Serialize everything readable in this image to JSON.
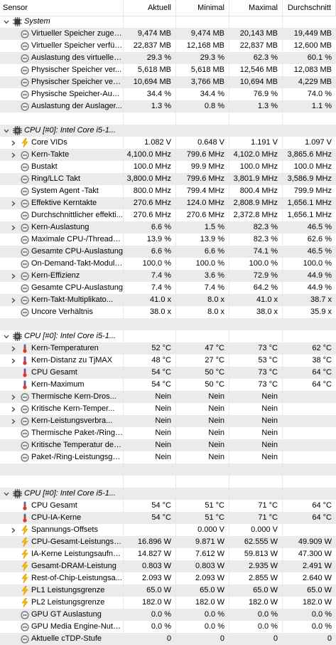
{
  "columns": [
    "Sensor",
    "Aktuell",
    "Minimal",
    "Maximal",
    "Durchschnitt"
  ],
  "rows": [
    {
      "type": "group",
      "indent": 0,
      "expander": "down",
      "icon": "memory-chip-icon",
      "label": "System"
    },
    {
      "type": "item",
      "indent": 1,
      "expander": "",
      "icon": "minus-circle-icon",
      "label": "Virtueller Speicher zugew...",
      "v": [
        "9,474 MB",
        "9,474 MB",
        "20,143 MB",
        "19,449 MB"
      ]
    },
    {
      "type": "item",
      "indent": 1,
      "expander": "",
      "icon": "minus-circle-icon",
      "label": "Virtueller Speicher verfüg...",
      "v": [
        "22,837 MB",
        "12,168 MB",
        "22,837 MB",
        "12,600 MB"
      ]
    },
    {
      "type": "item",
      "indent": 1,
      "expander": "",
      "icon": "minus-circle-icon",
      "label": "Auslastung des virtuellen...",
      "v": [
        "29.3 %",
        "29.3 %",
        "62.3 %",
        "60.1 %"
      ]
    },
    {
      "type": "item",
      "indent": 1,
      "expander": "",
      "icon": "minus-circle-icon",
      "label": "Physischer Speicher ver...",
      "v": [
        "5,618 MB",
        "5,618 MB",
        "12,546 MB",
        "12,083 MB"
      ]
    },
    {
      "type": "item",
      "indent": 1,
      "expander": "",
      "icon": "minus-circle-icon",
      "label": "Physischer Speicher verf...",
      "v": [
        "10,694 MB",
        "3,766 MB",
        "10,694 MB",
        "4,229 MB"
      ]
    },
    {
      "type": "item",
      "indent": 1,
      "expander": "",
      "icon": "minus-circle-icon",
      "label": "Physische Speicher-Ausla...",
      "v": [
        "34.4 %",
        "34.4 %",
        "76.9 %",
        "74.0 %"
      ]
    },
    {
      "type": "item",
      "indent": 1,
      "expander": "",
      "icon": "minus-circle-icon",
      "label": "Auslastung der Auslager...",
      "v": [
        "1.3 %",
        "0.8 %",
        "1.3 %",
        "1.1 %"
      ]
    },
    {
      "type": "sep"
    },
    {
      "type": "group",
      "indent": 0,
      "expander": "down",
      "icon": "cpu-chip-icon",
      "label": "CPU [#0]: Intel Core i5-1..."
    },
    {
      "type": "item",
      "indent": 1,
      "expander": "right",
      "icon": "lightning-icon",
      "label": "Core VIDs",
      "v": [
        "1.082 V",
        "0.648 V",
        "1.191 V",
        "1.097 V"
      ]
    },
    {
      "type": "item",
      "indent": 1,
      "expander": "right",
      "icon": "minus-circle-icon",
      "label": "Kern-Takte",
      "v": [
        "4,100.0 MHz",
        "799.6 MHz",
        "4,102.0 MHz",
        "3,865.6 MHz"
      ]
    },
    {
      "type": "item",
      "indent": 1,
      "expander": "",
      "icon": "minus-circle-icon",
      "label": "Bustakt",
      "v": [
        "100.0 MHz",
        "99.9 MHz",
        "100.0 MHz",
        "100.0 MHz"
      ]
    },
    {
      "type": "item",
      "indent": 1,
      "expander": "",
      "icon": "minus-circle-icon",
      "label": "Ring/LLC Takt",
      "v": [
        "3,800.0 MHz",
        "799.6 MHz",
        "3,801.9 MHz",
        "3,586.9 MHz"
      ]
    },
    {
      "type": "item",
      "indent": 1,
      "expander": "",
      "icon": "minus-circle-icon",
      "label": "System Agent -Takt",
      "v": [
        "800.0 MHz",
        "799.4 MHz",
        "800.4 MHz",
        "799.9 MHz"
      ]
    },
    {
      "type": "item",
      "indent": 1,
      "expander": "right",
      "icon": "minus-circle-icon",
      "label": "Effektive Kerntakte",
      "v": [
        "270.6 MHz",
        "124.0 MHz",
        "2,808.9 MHz",
        "1,656.1 MHz"
      ]
    },
    {
      "type": "item",
      "indent": 1,
      "expander": "",
      "icon": "minus-circle-icon",
      "label": "Durchschnittlicher effekti...",
      "v": [
        "270.6 MHz",
        "270.6 MHz",
        "2,372.8 MHz",
        "1,656.1 MHz"
      ]
    },
    {
      "type": "item",
      "indent": 1,
      "expander": "right",
      "icon": "minus-circle-icon",
      "label": "Kern-Auslastung",
      "v": [
        "6.6 %",
        "1.5 %",
        "82.3 %",
        "46.5 %"
      ]
    },
    {
      "type": "item",
      "indent": 1,
      "expander": "",
      "icon": "minus-circle-icon",
      "label": "Maximale CPU-/Thread-A...",
      "v": [
        "13.9 %",
        "13.9 %",
        "82.3 %",
        "62.6 %"
      ]
    },
    {
      "type": "item",
      "indent": 1,
      "expander": "",
      "icon": "minus-circle-icon",
      "label": "Gesamte CPU-Auslastung",
      "v": [
        "6.6 %",
        "6.6 %",
        "74.1 %",
        "46.5 %"
      ]
    },
    {
      "type": "item",
      "indent": 1,
      "expander": "",
      "icon": "minus-circle-icon",
      "label": "On-Demand-Takt-Modula...",
      "v": [
        "100.0 %",
        "100.0 %",
        "100.0 %",
        "100.0 %"
      ]
    },
    {
      "type": "item",
      "indent": 1,
      "expander": "right",
      "icon": "minus-circle-icon",
      "label": "Kern-Effizienz",
      "v": [
        "7.4 %",
        "3.6 %",
        "72.9 %",
        "44.9 %"
      ]
    },
    {
      "type": "item",
      "indent": 1,
      "expander": "",
      "icon": "minus-circle-icon",
      "label": "Gesamte CPU-Auslastung",
      "v": [
        "7.4 %",
        "7.4 %",
        "64.2 %",
        "44.9 %"
      ]
    },
    {
      "type": "item",
      "indent": 1,
      "expander": "right",
      "icon": "minus-circle-icon",
      "label": "Kern-Takt-Multiplikato...",
      "v": [
        "41.0 x",
        "8.0 x",
        "41.0 x",
        "38.7 x"
      ]
    },
    {
      "type": "item",
      "indent": 1,
      "expander": "",
      "icon": "minus-circle-icon",
      "label": "Uncore Verhältnis",
      "v": [
        "38.0 x",
        "8.0 x",
        "38.0 x",
        "35.9 x"
      ]
    },
    {
      "type": "sep"
    },
    {
      "type": "group",
      "indent": 0,
      "expander": "down",
      "icon": "cpu-chip-icon",
      "label": "CPU [#0]: Intel Core i5-1..."
    },
    {
      "type": "item",
      "indent": 1,
      "expander": "right",
      "icon": "thermometer-icon",
      "label": "Kern-Temperaturen",
      "v": [
        "52 °C",
        "47 °C",
        "73 °C",
        "62 °C"
      ]
    },
    {
      "type": "item",
      "indent": 1,
      "expander": "right",
      "icon": "thermometer-icon",
      "label": "Kern-Distanz zu TjMAX",
      "v": [
        "48 °C",
        "27 °C",
        "53 °C",
        "38 °C"
      ]
    },
    {
      "type": "item",
      "indent": 1,
      "expander": "",
      "icon": "thermometer-icon",
      "label": "CPU Gesamt",
      "v": [
        "54 °C",
        "50 °C",
        "73 °C",
        "64 °C"
      ]
    },
    {
      "type": "item",
      "indent": 1,
      "expander": "",
      "icon": "thermometer-icon",
      "label": "Kern-Maximum",
      "v": [
        "54 °C",
        "50 °C",
        "73 °C",
        "64 °C"
      ]
    },
    {
      "type": "item",
      "indent": 1,
      "expander": "right",
      "icon": "minus-circle-icon",
      "label": "Thermische Kern-Dros...",
      "v": [
        "Nein",
        "Nein",
        "Nein",
        ""
      ]
    },
    {
      "type": "item",
      "indent": 1,
      "expander": "right",
      "icon": "minus-circle-icon",
      "label": "Kritische Kern-Temper...",
      "v": [
        "Nein",
        "Nein",
        "Nein",
        ""
      ]
    },
    {
      "type": "item",
      "indent": 1,
      "expander": "right",
      "icon": "minus-circle-icon",
      "label": "Kern-Leistungsverbra...",
      "v": [
        "Nein",
        "Nein",
        "Nein",
        ""
      ]
    },
    {
      "type": "item",
      "indent": 1,
      "expander": "",
      "icon": "minus-circle-icon",
      "label": "Thermische Paket-/Ring-...",
      "v": [
        "Nein",
        "Nein",
        "Nein",
        ""
      ]
    },
    {
      "type": "item",
      "indent": 1,
      "expander": "",
      "icon": "minus-circle-icon",
      "label": "Kritische Temperatur des...",
      "v": [
        "Nein",
        "Nein",
        "Nein",
        ""
      ]
    },
    {
      "type": "item",
      "indent": 1,
      "expander": "",
      "icon": "minus-circle-icon",
      "label": "Paket-/Ring-Leistungsgre...",
      "v": [
        "Nein",
        "Nein",
        "Nein",
        ""
      ]
    },
    {
      "type": "sep"
    },
    {
      "type": "sep"
    },
    {
      "type": "group",
      "indent": 0,
      "expander": "down",
      "icon": "cpu-chip-icon",
      "label": "CPU [#0]: Intel Core i5-1..."
    },
    {
      "type": "item",
      "indent": 1,
      "expander": "",
      "icon": "thermometer-icon",
      "label": "CPU Gesamt",
      "v": [
        "54 °C",
        "51 °C",
        "71 °C",
        "64 °C"
      ]
    },
    {
      "type": "item",
      "indent": 1,
      "expander": "",
      "icon": "thermometer-icon",
      "label": "CPU-IA-Kerne",
      "v": [
        "54 °C",
        "51 °C",
        "71 °C",
        "64 °C"
      ]
    },
    {
      "type": "item",
      "indent": 1,
      "expander": "right",
      "icon": "lightning-icon",
      "label": "Spannungs-Offsets",
      "v": [
        "",
        "0.000 V",
        "0.000 V",
        ""
      ]
    },
    {
      "type": "item",
      "indent": 1,
      "expander": "",
      "icon": "lightning-icon",
      "label": "CPU-Gesamt-Leistungsau...",
      "v": [
        "16.896 W",
        "9.871 W",
        "62.555 W",
        "49.909 W"
      ]
    },
    {
      "type": "item",
      "indent": 1,
      "expander": "",
      "icon": "lightning-icon",
      "label": "IA-Kerne Leistungsaufna...",
      "v": [
        "14.827 W",
        "7.612 W",
        "59.813 W",
        "47.300 W"
      ]
    },
    {
      "type": "item",
      "indent": 1,
      "expander": "",
      "icon": "lightning-icon",
      "label": "Gesamt-DRAM-Leistung",
      "v": [
        "0.803 W",
        "0.803 W",
        "2.935 W",
        "2.491 W"
      ]
    },
    {
      "type": "item",
      "indent": 1,
      "expander": "",
      "icon": "lightning-icon",
      "label": "Rest-of-Chip-Leistungsa...",
      "v": [
        "2.093 W",
        "2.093 W",
        "2.855 W",
        "2.640 W"
      ]
    },
    {
      "type": "item",
      "indent": 1,
      "expander": "",
      "icon": "lightning-icon",
      "label": "PL1 Leistungsgrenze",
      "v": [
        "65.0 W",
        "65.0 W",
        "65.0 W",
        "65.0 W"
      ]
    },
    {
      "type": "item",
      "indent": 1,
      "expander": "",
      "icon": "lightning-icon",
      "label": "PL2 Leistungsgrenze",
      "v": [
        "182.0 W",
        "182.0 W",
        "182.0 W",
        "182.0 W"
      ]
    },
    {
      "type": "item",
      "indent": 1,
      "expander": "",
      "icon": "minus-circle-icon",
      "label": "GPU GT Auslastung",
      "v": [
        "0.0 %",
        "0.0 %",
        "0.0 %",
        "0.0 %"
      ]
    },
    {
      "type": "item",
      "indent": 1,
      "expander": "",
      "icon": "minus-circle-icon",
      "label": "GPU Media Engine-Nutzung",
      "v": [
        "0.0 %",
        "0.0 %",
        "0.0 %",
        "0.0 %"
      ]
    },
    {
      "type": "item",
      "indent": 1,
      "expander": "",
      "icon": "minus-circle-icon",
      "label": "Aktuelle cTDP-Stufe",
      "v": [
        "0",
        "0",
        "0",
        "0"
      ]
    }
  ],
  "colors": {
    "alt_row": "#ebebeb",
    "thermometer_red": "#d93a2b",
    "thermometer_blue": "#3a6fd9",
    "lightning_yellow": "#f2c200",
    "lightning_orange": "#e08a00",
    "chip_dark": "#3c3c3c",
    "circle_gray": "#6b6b6b"
  }
}
